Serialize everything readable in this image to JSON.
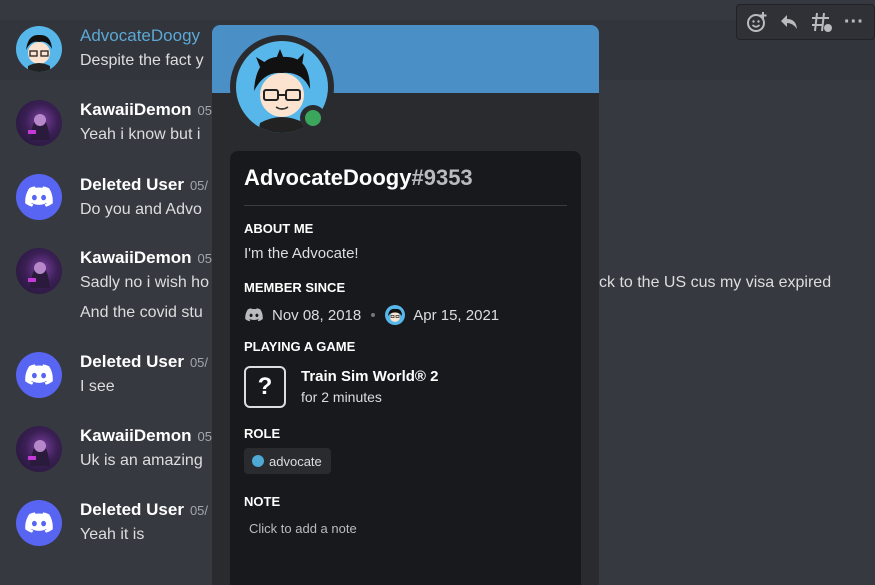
{
  "messages": [
    {
      "author": "AdvocateDoogy",
      "timestamp": "",
      "text": "Despite the fact y"
    },
    {
      "author": "KawaiiDemon",
      "timestamp": "05",
      "text": "Yeah i know but i"
    },
    {
      "author": "Deleted User",
      "timestamp": "05/",
      "text": "Do you and Advo"
    },
    {
      "author": "KawaiiDemon",
      "timestamp": "05",
      "text": "Sadly no i wish ho",
      "continuation": "And the covid stu",
      "overflow_text": "ck to the US cus my visa expired"
    },
    {
      "author": "Deleted User",
      "timestamp": "05/",
      "text": "I see"
    },
    {
      "author": "KawaiiDemon",
      "timestamp": "05",
      "text": "Uk is an amazing"
    },
    {
      "author": "Deleted User",
      "timestamp": "05/",
      "text": "Yeah it is"
    }
  ],
  "toolbar": {
    "icons": [
      "add-reaction-icon",
      "reply-icon",
      "create-thread-icon",
      "more-icon"
    ],
    "more_glyph": "···"
  },
  "profile": {
    "username": "AdvocateDoogy",
    "discriminator": "#9353",
    "status": "online",
    "about_me_header": "ABOUT ME",
    "about_me": "I'm the Advocate!",
    "member_since_header": "MEMBER SINCE",
    "discord_since": "Nov 08, 2018",
    "server_since": "Apr 15, 2021",
    "playing_header": "PLAYING A GAME",
    "game_icon_glyph": "?",
    "game_name": "Train Sim World® 2",
    "game_time": "for 2 minutes",
    "role_header": "ROLE",
    "role": "advocate",
    "note_header": "NOTE",
    "note_placeholder": "Click to add a note"
  },
  "colors": {
    "background": "#36393f",
    "banner": "#4a8fc5",
    "online": "#3ba55c",
    "discord_blurple": "#5865f2",
    "role_color": "#4eaad4",
    "mention_blue": "#5ba8d6"
  }
}
